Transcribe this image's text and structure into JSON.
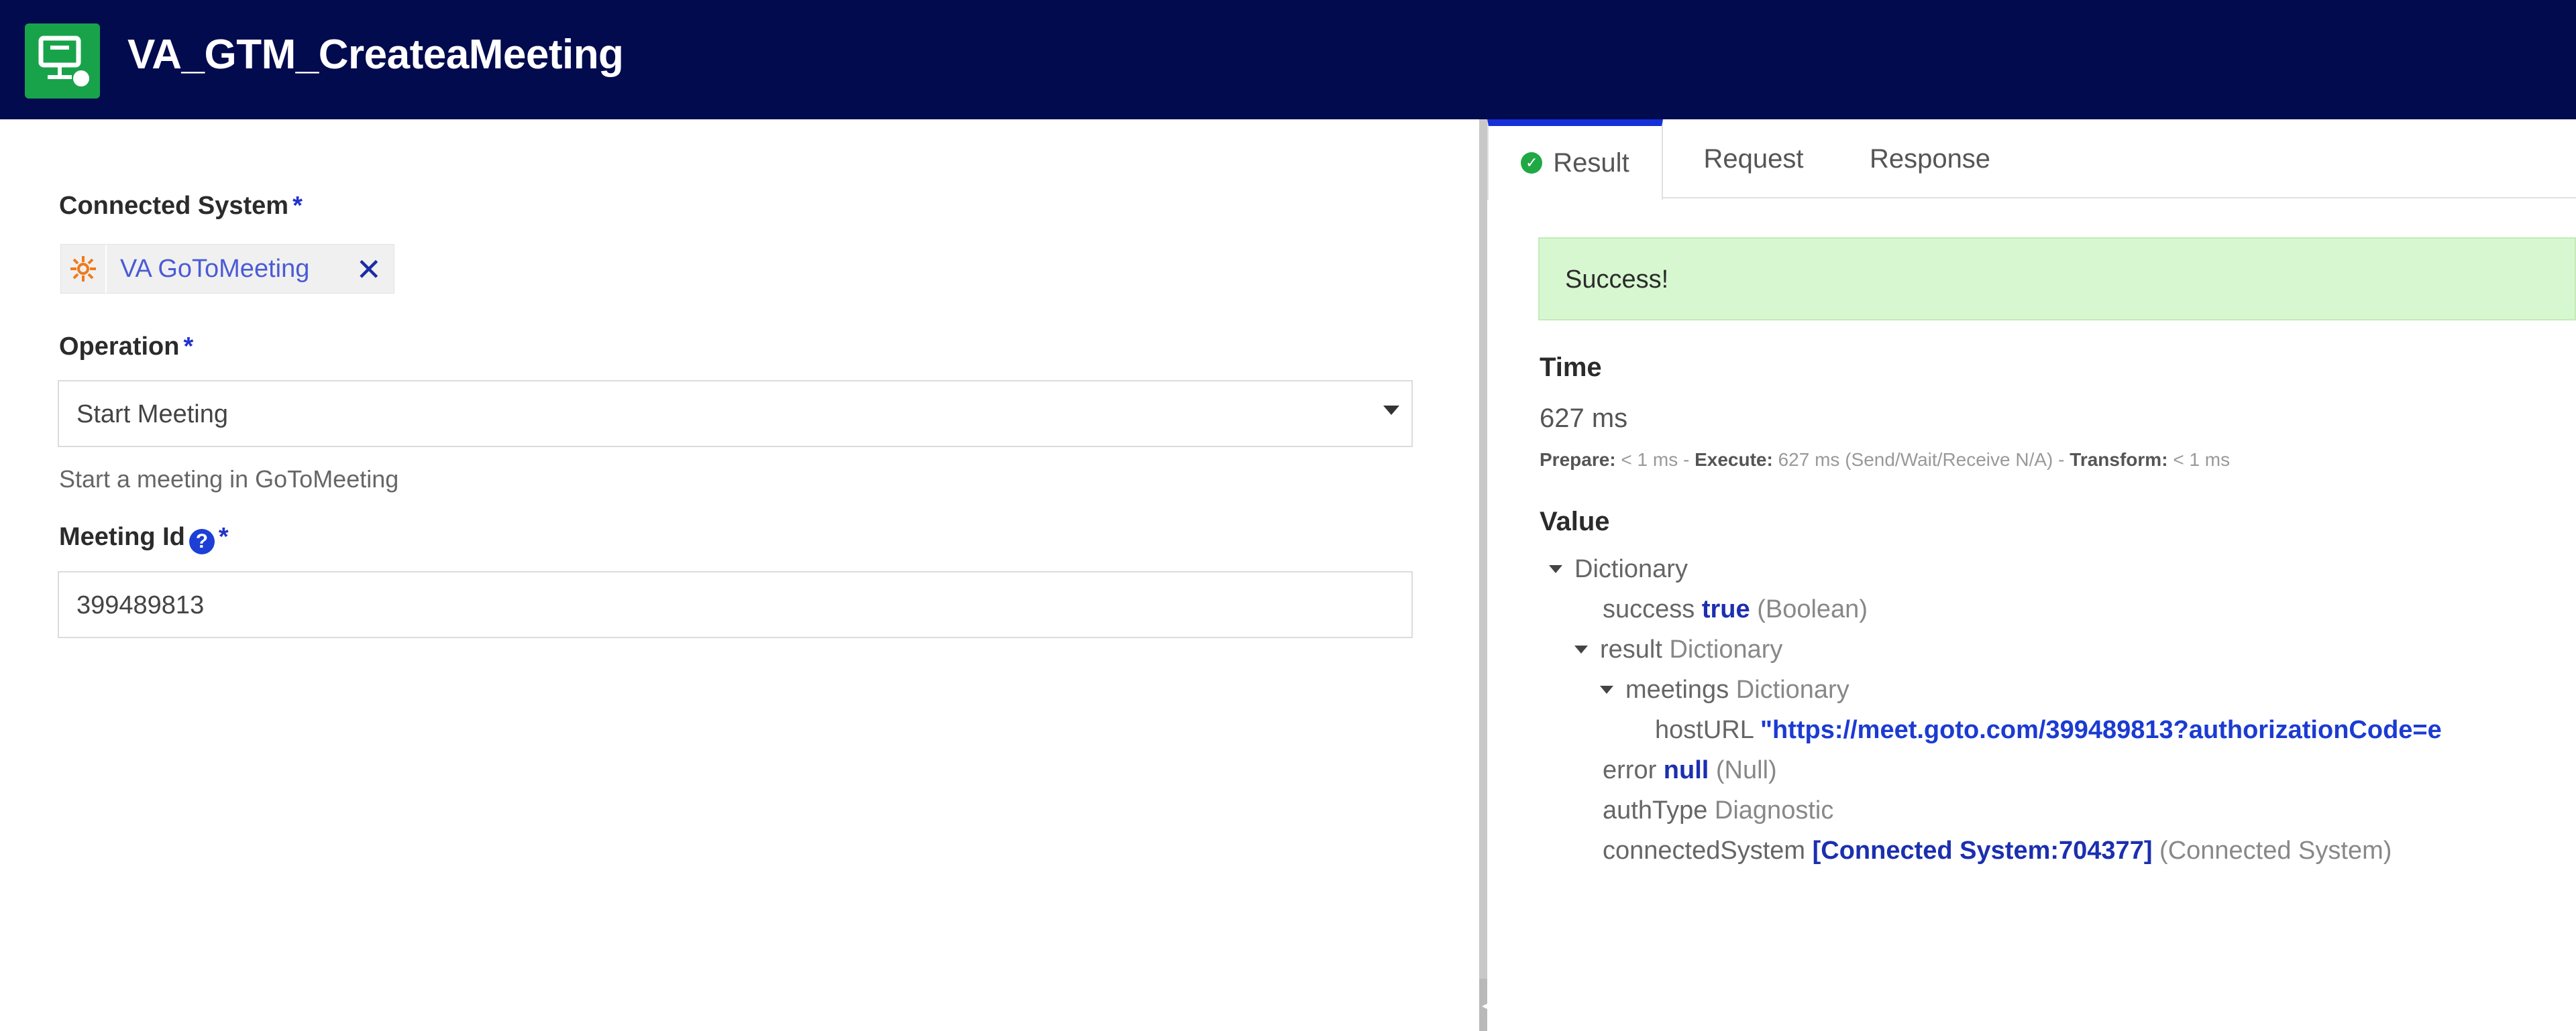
{
  "header": {
    "title": "VA_GTM_CreateaMeeting",
    "icon": "integration-icon"
  },
  "form": {
    "connected_system_label": "Connected System",
    "required_mark": "*",
    "connected_system_value": "VA GoToMeeting",
    "chip_remove": "✕",
    "operation_label": "Operation",
    "operation_value": "Start Meeting",
    "operation_hint": "Start a meeting in GoToMeeting",
    "meeting_id_label": "Meeting Id",
    "meeting_id_help": "?",
    "meeting_id_value": "399489813"
  },
  "tabs": [
    {
      "label": "Result",
      "active": true
    },
    {
      "label": "Request",
      "active": false
    },
    {
      "label": "Response",
      "active": false
    }
  ],
  "result": {
    "status": "Success!",
    "time_label": "Time",
    "time_value": "627 ms",
    "prepare_label": "Prepare:",
    "prepare_value": "< 1 ms",
    "sep1": " - ",
    "execute_label": "Execute:",
    "execute_value": "627 ms (Send/Wait/Receive N/A)",
    "sep2": " - ",
    "transform_label": "Transform:",
    "transform_value": "< 1 ms",
    "value_label": "Value",
    "tree": {
      "root_type": "Dictionary",
      "success_key": "success",
      "success_value": "true",
      "success_type": "(Boolean)",
      "result_key": "result",
      "result_type": "Dictionary",
      "meetings_key": "meetings",
      "meetings_type": "Dictionary",
      "hosturl_key": "hostURL",
      "hosturl_value": "\"https://meet.goto.com/399489813?authorizationCode=e",
      "error_key": "error",
      "error_value": "null",
      "error_type": "(Null)",
      "authtype_key": "authType",
      "authtype_value": "Diagnostic",
      "cs_key": "connectedSystem",
      "cs_value": "[Connected System:704377]",
      "cs_type": "(Connected System)"
    }
  },
  "colors": {
    "header_bg": "#030b4f",
    "accent": "#1530d8",
    "success_bg": "#d7f7d0",
    "app_icon_bg": "#18a34a"
  }
}
